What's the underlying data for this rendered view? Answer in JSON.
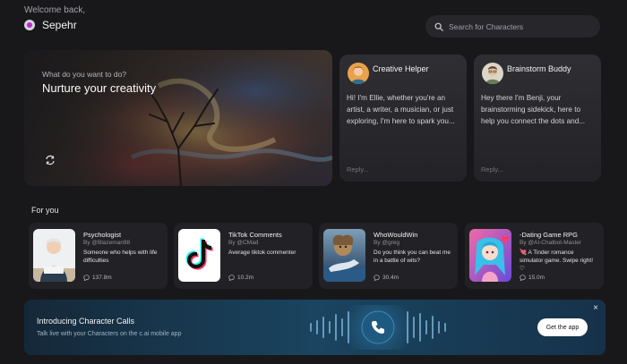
{
  "header": {
    "welcome": "Welcome back,",
    "user_name": "Sepehr",
    "search_placeholder": "Search for Characters"
  },
  "hero": {
    "question": "What do you want to do?",
    "title": "Nurture your creativity"
  },
  "chats": [
    {
      "name": "Creative Helper",
      "message": "Hi! I'm Ellie, whether you're an artist, a writer, a musician, or just exploring, I'm here to spark you...",
      "reply_placeholder": "Reply..."
    },
    {
      "name": "Brainstorm Buddy",
      "message": "Hey there I'm Benji, your brainstorming sidekick, here to help you connect the dots and...",
      "reply_placeholder": "Reply..."
    }
  ],
  "for_you": {
    "title": "For you",
    "characters": [
      {
        "name": "Psychologist",
        "by": "By @Blazeman98",
        "desc": "Someone who helps with life difficulties",
        "count": "137.8m"
      },
      {
        "name": "TikTok Comments",
        "by": "By @CMad",
        "desc": "Average tiktok commenter",
        "count": "10.2m"
      },
      {
        "name": "WhoWouldWin",
        "by": "By @greg",
        "desc": "Do you think you can beat me in a battle of wits?",
        "count": "30.4m"
      },
      {
        "name": "-Dating Game RPG",
        "by": "By @AI-Chatbot-Master",
        "desc": "💘 A Tinder romance simulator game. Swipe right! ♡",
        "count": "15.0m"
      }
    ]
  },
  "banner": {
    "title": "Introducing Character Calls",
    "subtitle": "Talk live with your Characters on the c.ai mobile app",
    "button": "Get the app",
    "close": "×"
  }
}
